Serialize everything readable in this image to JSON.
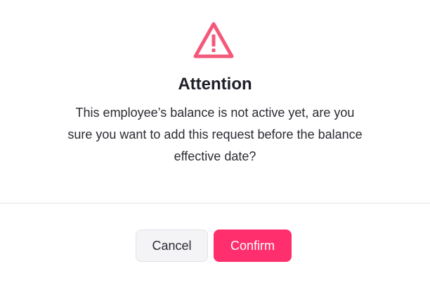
{
  "dialog": {
    "icon": "warning-triangle-icon",
    "title": "Attention",
    "message": "This employee’s balance is not active yet, are you sure you want to add this request before the balance effective date?",
    "cancel_label": "Cancel",
    "confirm_label": "Confirm"
  },
  "colors": {
    "accent": "#ff2f6d",
    "warning_icon": "#f4587a",
    "text_primary": "#1f1f2b",
    "cancel_bg": "#f4f4f7"
  }
}
